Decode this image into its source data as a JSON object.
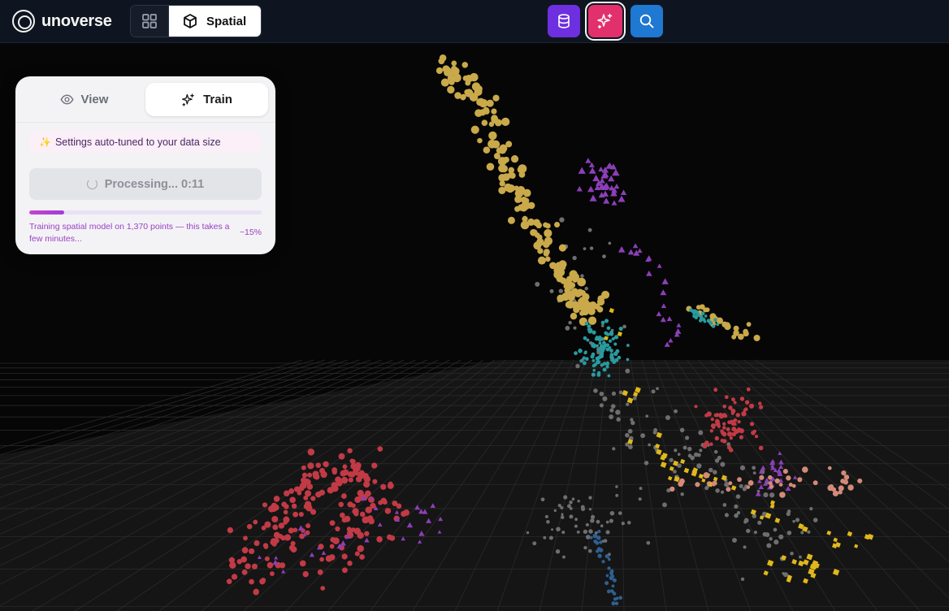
{
  "app": {
    "name": "unoverse"
  },
  "toolbar": {
    "grid_icon": "grid-icon",
    "spatial_label": "Spatial",
    "spatial_icon": "cube-icon",
    "actions": [
      {
        "name": "database-button",
        "icon": "database-icon",
        "color": "#6d2fe0"
      },
      {
        "name": "train-button",
        "icon": "sparkles-icon",
        "color": "#e1306c"
      },
      {
        "name": "search-button",
        "icon": "search-icon",
        "color": "#1f78d1"
      }
    ]
  },
  "panel": {
    "tabs": [
      {
        "label": "View",
        "icon": "eye-icon",
        "active": false
      },
      {
        "label": "Train",
        "icon": "sparkles-icon",
        "active": true
      }
    ],
    "hint_icon": "✨",
    "hint_text": "Settings auto-tuned to your data size",
    "processing_label": "Processing... 0:11",
    "progress_fraction": 0.15,
    "status_text": "Training spatial model on 1,370 points — this takes a few minutes...",
    "progress_text": "~15%"
  },
  "scene": {
    "background": "#060606",
    "floor_color": "#161616",
    "grid_color": "#2a2a2a",
    "clusters": [
      {
        "name": "gold-cluster",
        "color": "#c9a94a",
        "shape": "circle"
      },
      {
        "name": "purple-cluster",
        "color": "#8b3fb8",
        "shape": "triangle"
      },
      {
        "name": "teal-cluster",
        "color": "#2a9a9e",
        "shape": "circle"
      },
      {
        "name": "red-cluster",
        "color": "#c23a45",
        "shape": "circle"
      },
      {
        "name": "yellow-cluster",
        "color": "#e0b81a",
        "shape": "cube"
      },
      {
        "name": "gray-cluster",
        "color": "#6e6e6e",
        "shape": "circle"
      },
      {
        "name": "salmon-cluster",
        "color": "#d48a78",
        "shape": "circle"
      },
      {
        "name": "blue-cluster",
        "color": "#2f5f8f",
        "shape": "circle"
      }
    ]
  }
}
